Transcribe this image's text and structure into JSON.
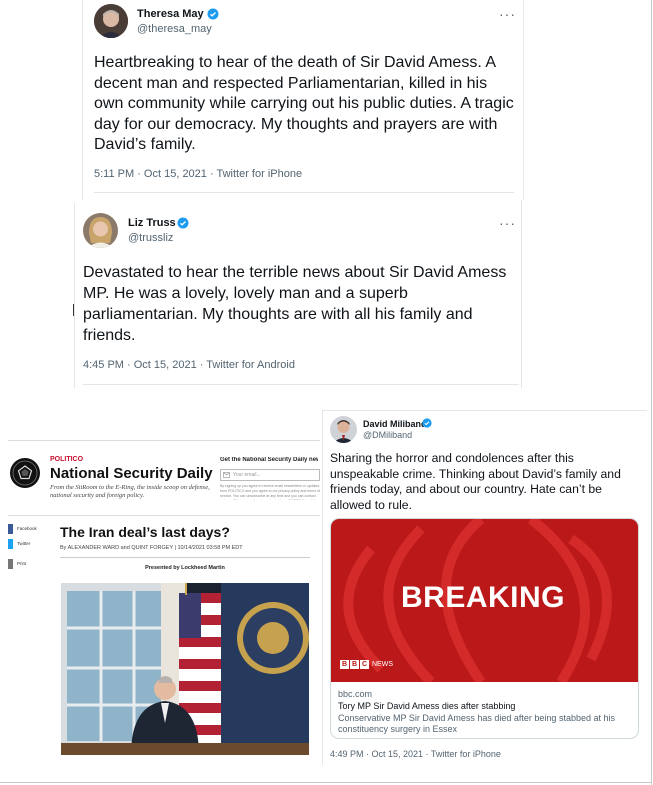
{
  "tweets": [
    {
      "name": "Theresa May",
      "handle": "@theresa_may",
      "text": "Heartbreaking to hear of the death of Sir David Amess. A decent man and respected Parliamentarian, killed in his own community while carrying out his public duties. A tragic day for our democracy. My thoughts and prayers are with David’s family.",
      "meta": "5:11 PM · Oct 15, 2021 · Twitter for iPhone"
    },
    {
      "name": "Liz Truss",
      "handle": "@trussliz",
      "text": "Devastated to hear the terrible news about Sir David Amess MP. He was a lovely, lovely man and a superb parliamentarian. My thoughts are with all his family and friends.",
      "meta": "4:45 PM · Oct 15, 2021 · Twitter for Android"
    },
    {
      "name": "David Miliband",
      "handle": "@DMiliband",
      "text": "Sharing the horror and condolences after this unspeakable crime.  Thinking about David’s family and friends today, and about our country. Hate can’t be allowed to rule.",
      "meta": "4:49 PM · Oct 15, 2021 · Twitter for iPhone",
      "card": {
        "headline_image_text": "BREAKING",
        "bbc_letters": [
          "B",
          "B",
          "C"
        ],
        "bbc_news": "NEWS",
        "url": "bbc.com",
        "title": "Tory MP Sir David Amess dies after stabbing",
        "description": "Conservative MP Sir David Amess has died after being stabbed at his constituency surgery in Essex"
      }
    }
  ],
  "more_icon": "···",
  "politico": {
    "brand": "POLITICO",
    "newsletter": "National Security Daily",
    "tagline": "From the SitRoom to the E-Ring, the inside scoop on defense, national security and foreign policy.",
    "signup_heading": "Get the National Security Daily newsle",
    "email_placeholder": "Your email...",
    "fine_print": "By signing up you agree to receive email newsletters or updates from POLITICO and you agree to our privacy policy and terms of service. You can unsubscribe at any time and you can contact us here. This sign-up form is protected by reCAPTCHA and the Google Privacy Policy and Terms of Service apply.",
    "share": [
      "Facebook",
      "Twitter",
      "Print"
    ],
    "article_title": "The Iran deal’s last days?",
    "byline": "By ALEXANDER WARD and QUINT FORGEY | 10/14/2021 03:58 PM EDT",
    "presented_by": "Presented by Lockheed Martin"
  },
  "colors": {
    "verified": "#1d9bf0",
    "bbc_red": "#bb1919",
    "politico_red": "#c8102e"
  }
}
